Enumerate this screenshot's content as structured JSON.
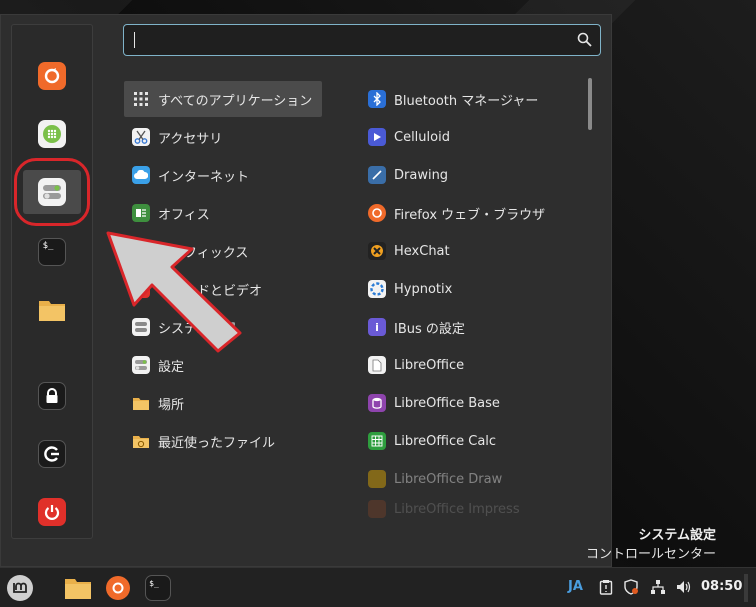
{
  "search": {
    "value": "",
    "placeholder": ""
  },
  "favorites": [
    {
      "name": "firefox",
      "icon": "firefox-icon"
    },
    {
      "name": "software-manager",
      "icon": "grid-icon"
    },
    {
      "name": "system-settings",
      "icon": "toggle-icon"
    },
    {
      "name": "terminal",
      "icon": "terminal-icon"
    },
    {
      "name": "files",
      "icon": "folder-icon"
    },
    {
      "name": "lock",
      "icon": "lock-icon"
    },
    {
      "name": "logout",
      "icon": "logout-icon"
    },
    {
      "name": "shutdown",
      "icon": "power-icon"
    }
  ],
  "categories": [
    {
      "label": "すべてのアプリケーション",
      "icon": "grid-dots-icon"
    },
    {
      "label": "アクセサリ",
      "icon": "scissors-icon"
    },
    {
      "label": "インターネット",
      "icon": "cloud-icon"
    },
    {
      "label": "オフィス",
      "icon": "office-icon"
    },
    {
      "label": "グラフィックス",
      "icon": "graphics-icon"
    },
    {
      "label": "サウンドとビデオ",
      "icon": "media-icon"
    },
    {
      "label": "システム管理",
      "icon": "system-icon"
    },
    {
      "label": "設定",
      "icon": "settings-icon"
    },
    {
      "label": "場所",
      "icon": "folder-icon"
    },
    {
      "label": "最近使ったファイル",
      "icon": "recent-icon"
    }
  ],
  "apps": [
    {
      "label": "Bluetooth マネージャー",
      "icon": "bluetooth-icon"
    },
    {
      "label": "Celluloid",
      "icon": "play-icon"
    },
    {
      "label": "Drawing",
      "icon": "pencil-icon"
    },
    {
      "label": "Firefox ウェブ・ブラウザ",
      "icon": "firefox-icon"
    },
    {
      "label": "HexChat",
      "icon": "hexchat-icon"
    },
    {
      "label": "Hypnotix",
      "icon": "hypnotix-icon"
    },
    {
      "label": "IBus の設定",
      "icon": "info-icon"
    },
    {
      "label": "LibreOffice",
      "icon": "document-icon"
    },
    {
      "label": "LibreOffice Base",
      "icon": "database-icon"
    },
    {
      "label": "LibreOffice Calc",
      "icon": "spreadsheet-icon"
    },
    {
      "label": "LibreOffice Draw",
      "icon": "draw-icon"
    },
    {
      "label": "LibreOffice Impress",
      "icon": "impress-icon"
    }
  ],
  "description": {
    "title": "システム設定",
    "text": "コントロールセンター"
  },
  "panel": {
    "lang": "JA",
    "time": "08:50"
  },
  "colors": {
    "accent": "#7fb3c9",
    "highlight": "#d9262a",
    "firefox": "#f06a2a",
    "green": "#7bc04a"
  }
}
